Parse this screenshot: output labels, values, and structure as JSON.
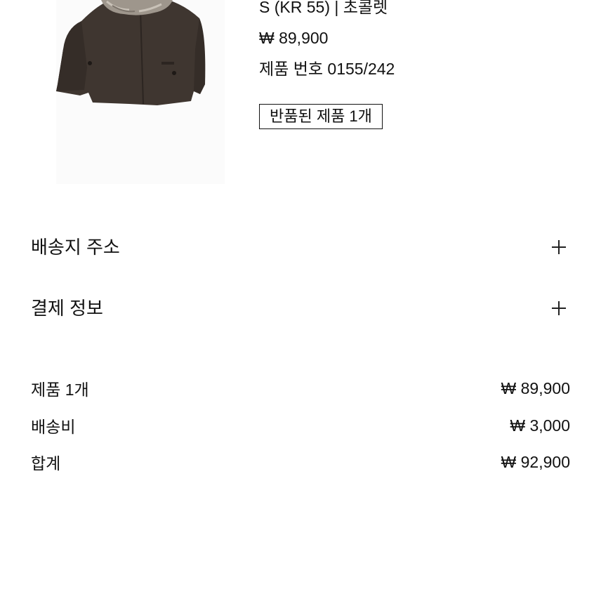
{
  "product": {
    "image_icon": "jacket-with-fur-collar",
    "variant": "S (KR 55) | 초콜렛",
    "price": "₩ 89,900",
    "reference": "제품 번호 0155/242",
    "returned_badge": "반품된 제품 1개"
  },
  "accordion": {
    "shipping_address": "배송지 주소",
    "payment_info": "결제 정보"
  },
  "summary": {
    "items_label": "제품 1개",
    "items_value": "₩ 89,900",
    "shipping_label": "배송비",
    "shipping_value": "₩ 3,000",
    "total_label": "합계",
    "total_value": "₩ 92,900"
  },
  "colors": {
    "jacket": "#3f3630",
    "fur": "#9e968c",
    "text": "#111111"
  }
}
